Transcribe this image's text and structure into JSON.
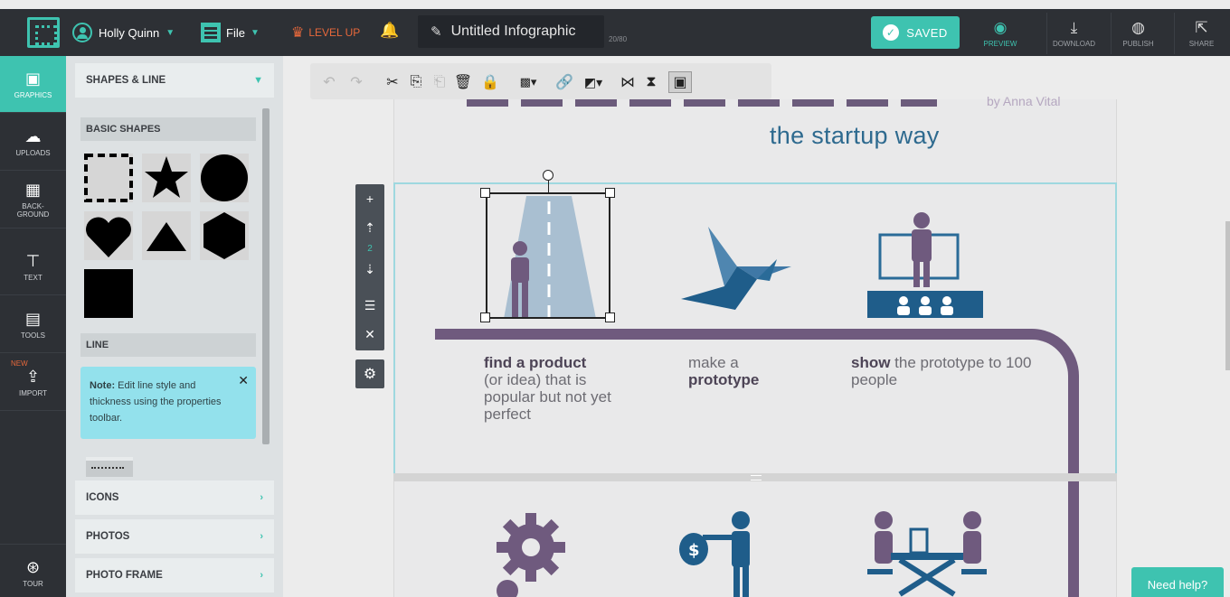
{
  "topbar": {
    "user_name": "Holly Quinn",
    "file_label": "File",
    "level_up_label": "LEVEL UP",
    "doc_title": "Untitled Infographic",
    "char_count": "20/80",
    "saved_label": "SAVED",
    "actions": [
      {
        "label": "PREVIEW",
        "icon": "eye-icon"
      },
      {
        "label": "DOWNLOAD",
        "icon": "download-icon"
      },
      {
        "label": "PUBLISH",
        "icon": "globe-icon"
      },
      {
        "label": "SHARE",
        "icon": "share-icon"
      }
    ]
  },
  "leftnav": {
    "items": [
      {
        "label": "GRAPHICS",
        "icon": "image-icon"
      },
      {
        "label": "UPLOADS",
        "icon": "cloud-upload-icon"
      },
      {
        "label": "BACK-\nGROUND",
        "icon": "background-icon"
      },
      {
        "label": "TEXT",
        "icon": "text-icon"
      },
      {
        "label": "TOOLS",
        "icon": "tools-icon"
      },
      {
        "label": "IMPORT",
        "icon": "import-icon",
        "badge": "NEW"
      }
    ],
    "tour_label": "TOUR"
  },
  "panel": {
    "header": "SHAPES & LINE",
    "basic_shapes_title": "BASIC SHAPES",
    "line_title": "LINE",
    "note_bold": "Note:",
    "note_text": " Edit line style and thickness using the properties toolbar.",
    "collapsed_sections": [
      "ICONS",
      "PHOTOS",
      "PHOTO FRAME"
    ]
  },
  "canvas": {
    "byline": "by Anna Vital",
    "subtitle": "the startup way",
    "layer_number": "2",
    "steps": [
      {
        "bold": "find a product",
        "rest": "(or idea) that is popular but not yet perfect"
      },
      {
        "normal": "make a",
        "bold": "prototype"
      },
      {
        "bold": "show",
        "rest": " the prototype to 100 people"
      }
    ]
  },
  "need_help_label": "Need help?",
  "colors": {
    "accent": "#3ec3b0",
    "dark": "#2d3035",
    "purple": "#6f5a7e",
    "blue": "#2e6a8f",
    "level_up": "#e7683b"
  }
}
